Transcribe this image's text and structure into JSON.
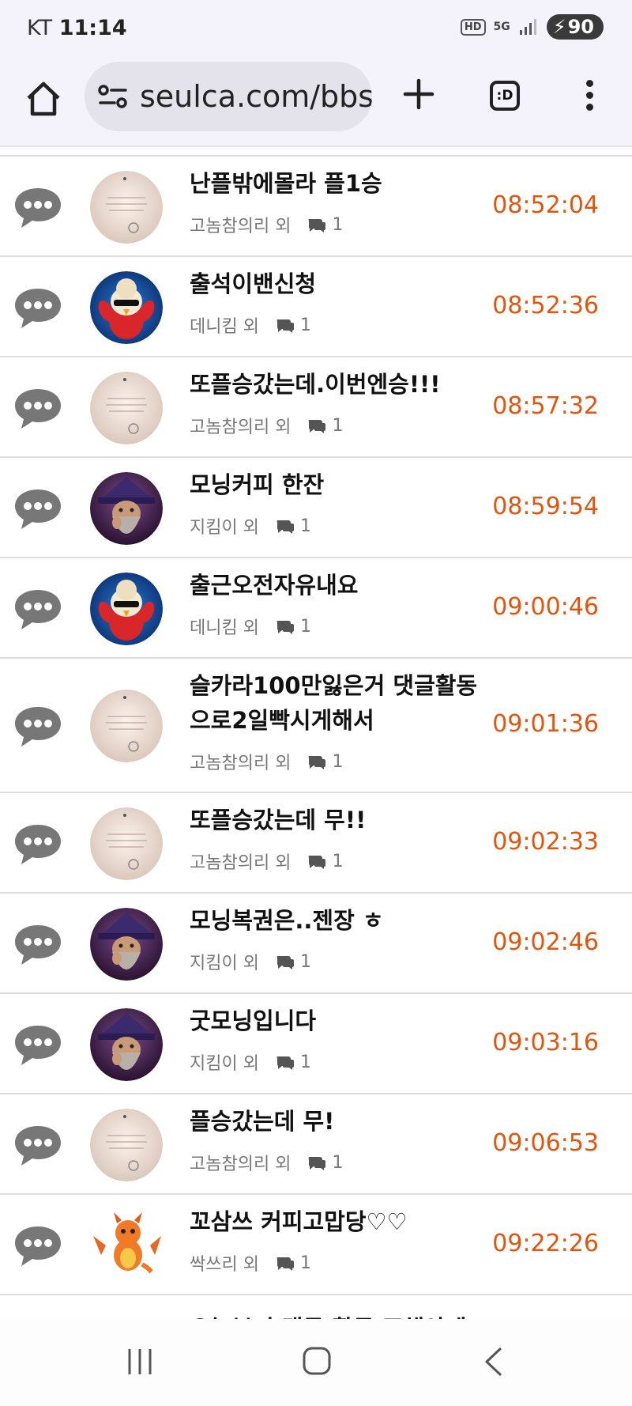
{
  "status_bar": {
    "carrier": "KT",
    "time": "11:14",
    "hd": "HD",
    "network": "5G",
    "battery": "90"
  },
  "browser": {
    "url": "seulca.com/bbs",
    "tabs_label": ":D"
  },
  "posts": [
    {
      "title_lines": [
        "난플밖에몰라 플1승"
      ],
      "author": "고놈참의리 외",
      "comments": "1",
      "time": "08:52:04",
      "avatar": "note"
    },
    {
      "title_lines": [
        "출석이밴신청"
      ],
      "author": "데니킴 외",
      "comments": "1",
      "time": "08:52:36",
      "avatar": "penguin"
    },
    {
      "title_lines": [
        "또플승갔는데.이번엔승!!!"
      ],
      "author": "고놈참의리 외",
      "comments": "1",
      "time": "08:57:32",
      "avatar": "note"
    },
    {
      "title_lines": [
        "모닝커피 한잔"
      ],
      "author": "지킴이 외",
      "comments": "1",
      "time": "08:59:54",
      "avatar": "wizard"
    },
    {
      "title_lines": [
        "출근오전자유내요"
      ],
      "author": "데니킴 외",
      "comments": "1",
      "time": "09:00:46",
      "avatar": "penguin"
    },
    {
      "title_lines": [
        "슬카라100만잃은거 댓글활동",
        "으로2일빡시게해서"
      ],
      "author": "고놈참의리 외",
      "comments": "1",
      "time": "09:01:36",
      "avatar": "note"
    },
    {
      "title_lines": [
        "또플승갔는데 무!!"
      ],
      "author": "고놈참의리 외",
      "comments": "1",
      "time": "09:02:33",
      "avatar": "note"
    },
    {
      "title_lines": [
        "모닝복권은..젠장 ㅎ"
      ],
      "author": "지킴이 외",
      "comments": "1",
      "time": "09:02:46",
      "avatar": "wizard"
    },
    {
      "title_lines": [
        "굿모닝입니다"
      ],
      "author": "지킴이 외",
      "comments": "1",
      "time": "09:03:16",
      "avatar": "wizard"
    },
    {
      "title_lines": [
        "플승갔는데 무!"
      ],
      "author": "고놈참의리 외",
      "comments": "1",
      "time": "09:06:53",
      "avatar": "note"
    },
    {
      "title_lines": [
        "꼬삼쓰 커피고맙당♡♡"
      ],
      "author": "싹쓰리 외",
      "comments": "1",
      "time": "09:22:26",
      "avatar": "dragon"
    },
    {
      "title_lines": [
        "오늘부터 댓글 활동 조해야게"
      ],
      "author": "",
      "comments": "",
      "time": "",
      "avatar": ""
    }
  ],
  "colors": {
    "time": "#e0560f",
    "chrome_bg": "#f4f2fb",
    "divider": "#dddddd"
  }
}
